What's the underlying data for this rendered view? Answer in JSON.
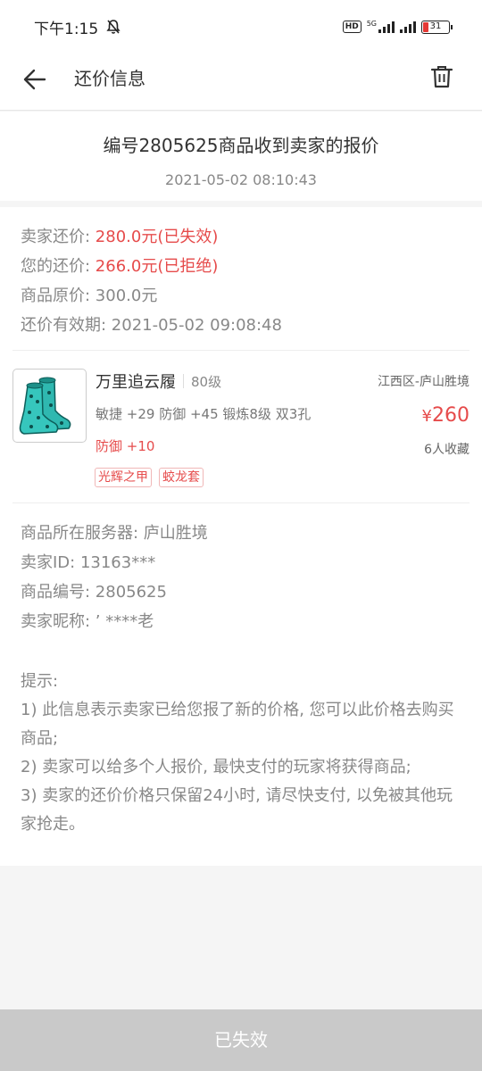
{
  "status": {
    "time": "下午1:15",
    "network": "5G",
    "battery": "31"
  },
  "nav": {
    "title": "还价信息"
  },
  "header": {
    "title": "编号2805625商品收到卖家的报价",
    "datetime": "2021-05-02 08:10:43"
  },
  "prices": {
    "seller_label": "卖家还价: ",
    "seller_value": "280.0元(已失效)",
    "mine_label": "您的还价: ",
    "mine_value": "266.0元(已拒绝)",
    "original": "商品原价: 300.0元",
    "expiry": "还价有效期: 2021-05-02 09:08:48"
  },
  "item": {
    "name": "万里追云履",
    "level": "80级",
    "server": "江西区-庐山胜境",
    "attrs": "敏捷 +29 防御 +45 锻炼8级 双3孔",
    "price_symbol": "¥",
    "price": "260",
    "extra": "防御 +10",
    "favorites": "6人收藏",
    "tags": [
      "光辉之甲",
      "蛟龙套"
    ]
  },
  "info": {
    "server": "商品所在服务器: 庐山胜境",
    "seller_id": "卖家ID: 13163***",
    "item_no": "商品编号: 2805625",
    "nickname": "卖家昵称: ’ ****老"
  },
  "tips": {
    "heading": "提示:",
    "line1": "1) 此信息表示卖家已给您报了新的价格, 您可以此价格去购买商品;",
    "line2": "2) 卖家可以给多个人报价, 最快支付的玩家将获得商品;",
    "line3": "3) 卖家的还价价格只保留24小时, 请尽快支付, 以免被其他玩家抢走。"
  },
  "footer": {
    "button": "已失效"
  }
}
